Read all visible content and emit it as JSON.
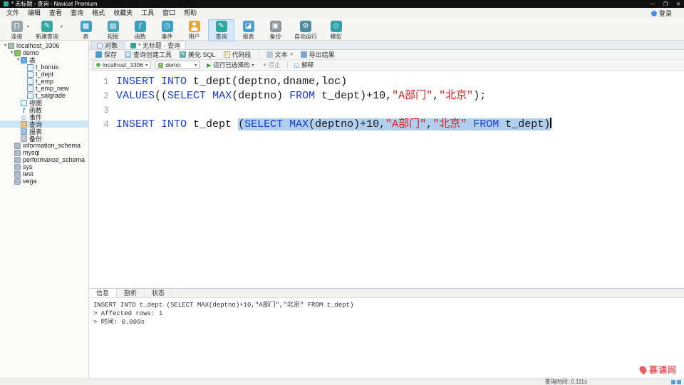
{
  "colors": {
    "accent": "#2fa89e",
    "keyword": "#1b3ed2",
    "string": "#d42020",
    "selection": "#b0cfee"
  },
  "window": {
    "title": "* 无标题 - 查询 - Navicat Premium",
    "login": "登录"
  },
  "menu": {
    "items": [
      {
        "label": "文件",
        "name": "file"
      },
      {
        "label": "编辑",
        "name": "edit"
      },
      {
        "label": "查看",
        "name": "view"
      },
      {
        "label": "查询",
        "name": "query"
      },
      {
        "label": "格式",
        "name": "format"
      },
      {
        "label": "收藏夹",
        "name": "favorites"
      },
      {
        "label": "工具",
        "name": "tools"
      },
      {
        "label": "窗口",
        "name": "window"
      },
      {
        "label": "帮助",
        "name": "help"
      }
    ]
  },
  "toolbar": {
    "items": [
      {
        "label": "连接",
        "icon": "connection",
        "arrow": true
      },
      {
        "label": "新建查询",
        "icon": "new-query",
        "arrow": true,
        "wide": true
      },
      {
        "label": "表",
        "icon": "table",
        "group": true
      },
      {
        "label": "视图",
        "icon": "view"
      },
      {
        "label": "函数",
        "icon": "function"
      },
      {
        "label": "事件",
        "icon": "event"
      },
      {
        "label": "用户",
        "icon": "user"
      },
      {
        "label": "查询",
        "icon": "query",
        "active": true
      },
      {
        "label": "报表",
        "icon": "report"
      },
      {
        "label": "备份",
        "icon": "backup"
      },
      {
        "label": "自动运行",
        "icon": "automation",
        "wide": true
      },
      {
        "label": "模型",
        "icon": "model"
      }
    ]
  },
  "sidebar": {
    "tree": [
      {
        "label": "localhost_3306",
        "level": 0,
        "icon": "connection",
        "name": "connection-localhost-3306",
        "expanded": true
      },
      {
        "label": "demo",
        "level": 1,
        "icon": "database",
        "name": "db-demo",
        "expanded": true
      },
      {
        "label": "表",
        "level": 2,
        "icon": "tables-folder",
        "name": "tables-folder",
        "expanded": true
      },
      {
        "label": "t_bonus",
        "level": 3,
        "icon": "table",
        "name": "table-t-bonus"
      },
      {
        "label": "t_dept",
        "level": 3,
        "icon": "table",
        "name": "table-t-dept"
      },
      {
        "label": "t_emp",
        "level": 3,
        "icon": "table",
        "name": "table-t-emp"
      },
      {
        "label": "t_emp_new",
        "level": 3,
        "icon": "table",
        "name": "table-t-emp-new"
      },
      {
        "label": "t_salgrade",
        "level": 3,
        "icon": "table",
        "name": "table-t-salgrade"
      },
      {
        "label": "视图",
        "level": 2,
        "icon": "views-folder",
        "name": "views-folder"
      },
      {
        "label": "函数",
        "level": 2,
        "icon": "functions-folder",
        "name": "functions-folder"
      },
      {
        "label": "事件",
        "level": 2,
        "icon": "events-folder",
        "name": "events-folder"
      },
      {
        "label": "查询",
        "level": 2,
        "icon": "queries-folder",
        "name": "queries-folder",
        "selected": true
      },
      {
        "label": "报表",
        "level": 2,
        "icon": "reports-folder",
        "name": "reports-folder"
      },
      {
        "label": "备份",
        "level": 2,
        "icon": "backups-folder",
        "name": "backups-folder"
      },
      {
        "label": "information_schema",
        "level": 1,
        "icon": "database-closed",
        "name": "db-information-schema"
      },
      {
        "label": "mysql",
        "level": 1,
        "icon": "database-closed",
        "name": "db-mysql"
      },
      {
        "label": "performance_schema",
        "level": 1,
        "icon": "database-closed",
        "name": "db-performance-schema"
      },
      {
        "label": "sys",
        "level": 1,
        "icon": "database-closed",
        "name": "db-sys"
      },
      {
        "label": "test",
        "level": 1,
        "icon": "database-closed",
        "name": "db-test"
      },
      {
        "label": "vega",
        "level": 1,
        "icon": "database-closed",
        "name": "db-vega"
      }
    ]
  },
  "tabs": {
    "objects": "对象",
    "query": "* 无标题 - 查询"
  },
  "query_toolbar": {
    "save": "保存",
    "builder": "查询创建工具",
    "beautify": "美化 SQL",
    "snippet": "代码段",
    "text": "文本",
    "export": "导出结果"
  },
  "run_toolbar": {
    "connection": "localhost_3306",
    "database": "demo",
    "run": "运行已选择的",
    "stop": "停止",
    "explain": "解释"
  },
  "editor": {
    "lines": [
      {
        "num": "1",
        "tokens": [
          {
            "t": "kw",
            "v": "INSERT"
          },
          {
            "t": "txt",
            "v": " "
          },
          {
            "t": "kw",
            "v": "INTO"
          },
          {
            "t": "txt",
            "v": " t_dept(deptno,dname,loc)"
          }
        ]
      },
      {
        "num": "2",
        "tokens": [
          {
            "t": "kw",
            "v": "VALUES"
          },
          {
            "t": "txt",
            "v": "(("
          },
          {
            "t": "kw",
            "v": "SELECT"
          },
          {
            "t": "txt",
            "v": " "
          },
          {
            "t": "kw",
            "v": "MAX"
          },
          {
            "t": "txt",
            "v": "(deptno) "
          },
          {
            "t": "kw",
            "v": "FROM"
          },
          {
            "t": "txt",
            "v": " t_dept)+10,"
          },
          {
            "t": "str",
            "v": "\"A部门\""
          },
          {
            "t": "txt",
            "v": ","
          },
          {
            "t": "str",
            "v": "\"北京\""
          },
          {
            "t": "txt",
            "v": ");"
          }
        ]
      },
      {
        "num": "3",
        "tokens": []
      },
      {
        "num": "4",
        "caret": true,
        "tokens": [
          {
            "t": "kw",
            "v": "INSERT"
          },
          {
            "t": "txt",
            "v": " "
          },
          {
            "t": "kw",
            "v": "INTO"
          },
          {
            "t": "txt",
            "v": " t_dept "
          },
          {
            "t": "txt",
            "v": "(",
            "sel": true
          },
          {
            "t": "kw",
            "v": "SELECT",
            "sel": true
          },
          {
            "t": "txt",
            "v": " ",
            "sel": true
          },
          {
            "t": "kw",
            "v": "MAX",
            "sel": true
          },
          {
            "t": "txt",
            "v": "(deptno)+10,",
            "sel": true
          },
          {
            "t": "str",
            "v": "\"A部门\"",
            "sel": true
          },
          {
            "t": "txt",
            "v": ",",
            "sel": true
          },
          {
            "t": "str",
            "v": "\"北京\"",
            "sel": true
          },
          {
            "t": "txt",
            "v": " ",
            "sel": true
          },
          {
            "t": "kw",
            "v": "FROM",
            "sel": true
          },
          {
            "t": "txt",
            "v": " t_dept)",
            "sel": true
          }
        ]
      }
    ]
  },
  "results": {
    "tabs": [
      {
        "label": "信息",
        "name": "info",
        "active": true
      },
      {
        "label": "剖析",
        "name": "profile"
      },
      {
        "label": "状态",
        "name": "status"
      }
    ],
    "lines": [
      "INSERT INTO t_dept (SELECT MAX(deptno)+10,\"A部门\",\"北京\" FROM t_dept)",
      "> Affected rows: 1",
      "> 时间: 0.009s"
    ]
  },
  "statusbar": {
    "query_time": "查询时间: 0.111s"
  },
  "watermark": {
    "text": "慕课网"
  }
}
